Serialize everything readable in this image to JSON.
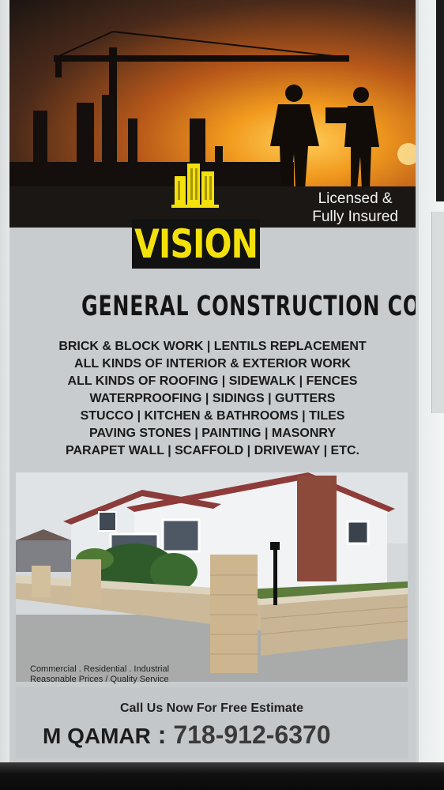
{
  "flyer": {
    "badge": {
      "line1": "Licensed &",
      "line2": "Fully Insured"
    },
    "logo": {
      "text": "VISION",
      "icon": "building-icon",
      "accent_color": "#f4e10c"
    },
    "company_name": "GENERAL CONSTRUCTION CORP",
    "services": [
      "BRICK & BLOCK WORK | LENTILS REPLACEMENT",
      "ALL KINDS OF INTERIOR & EXTERIOR WORK",
      "ALL KINDS OF ROOFING | SIDEWALK | FENCES",
      "WATERPROOFING |  SIDINGS | GUTTERS",
      "STUCCO | KITCHEN & BATHROOMS | TILES",
      "PAVING STONES | PAINTING | MASONRY",
      "PARAPET WALL | SCAFFOLD | DRIVEWAY | ETC."
    ],
    "tagline": {
      "line1": "Commercial . Residential . Industrial",
      "line2": "Reasonable  Prices / Quality Service"
    },
    "cta": "Call Us Now For Free Estimate",
    "contact": {
      "name": "M QAMAR",
      "separator": " : ",
      "phone": "718-912-6370"
    }
  }
}
